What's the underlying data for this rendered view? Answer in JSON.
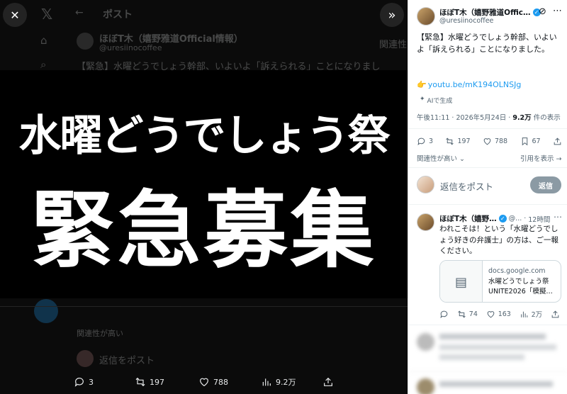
{
  "viewer": {
    "background": {
      "header_title": "ポスト",
      "author_name": "ほぼT木（嬉野雅道Official情報）",
      "author_handle": "@uresiinocoffee",
      "post_preview": "【緊急】水曜どうでしょう幹部、いよいよ「訴えられる」ことになりまし",
      "reply_placeholder": "返信をポスト",
      "relevance": "関連性が高い",
      "side_header": "関連性"
    },
    "media": {
      "line1": "水曜どうでしょう祭",
      "line2": "緊急募集"
    },
    "bottom_actions": {
      "replies": "3",
      "reposts": "197",
      "likes": "788",
      "views": "9.2万"
    }
  },
  "panel": {
    "tweet": {
      "author_name": "ほぼT木（嬉野雅道Offic…",
      "handle": "@uresiinocoffee",
      "text": "【緊急】水曜どうでしょう幹部、いよいよ「訴えられる」ことになりました。",
      "pointer": "👉",
      "link": "youtu.be/mK194OLNSJg",
      "ai_label": "AIで生成",
      "time": "午後11:11",
      "date": "2026年5月24日",
      "views_count": "9.2万",
      "views_label": "件の表示",
      "replies": "3",
      "reposts": "197",
      "likes": "788",
      "bookmarks": "67"
    },
    "filter": {
      "sort_label": "関連性が高い",
      "quotes_label": "引用を表示"
    },
    "composer": {
      "placeholder": "返信をポスト",
      "reply_button": "返信"
    },
    "reply": {
      "author_name": "ほぼT木（嬉野…",
      "handle": "@...",
      "time": "12時間",
      "text": "われこそは！という「水曜どうでしょう好きの弁護士」の方は、ご一報ください。",
      "card_domain": "docs.google.com",
      "card_title": "水曜どうでしょう祭UNITE2026「模擬…",
      "replies": "",
      "reposts": "74",
      "likes": "163",
      "views": "2万"
    }
  },
  "colors": {
    "accent": "#1d9bf0",
    "text": "#0f1419",
    "muted": "#536471"
  }
}
